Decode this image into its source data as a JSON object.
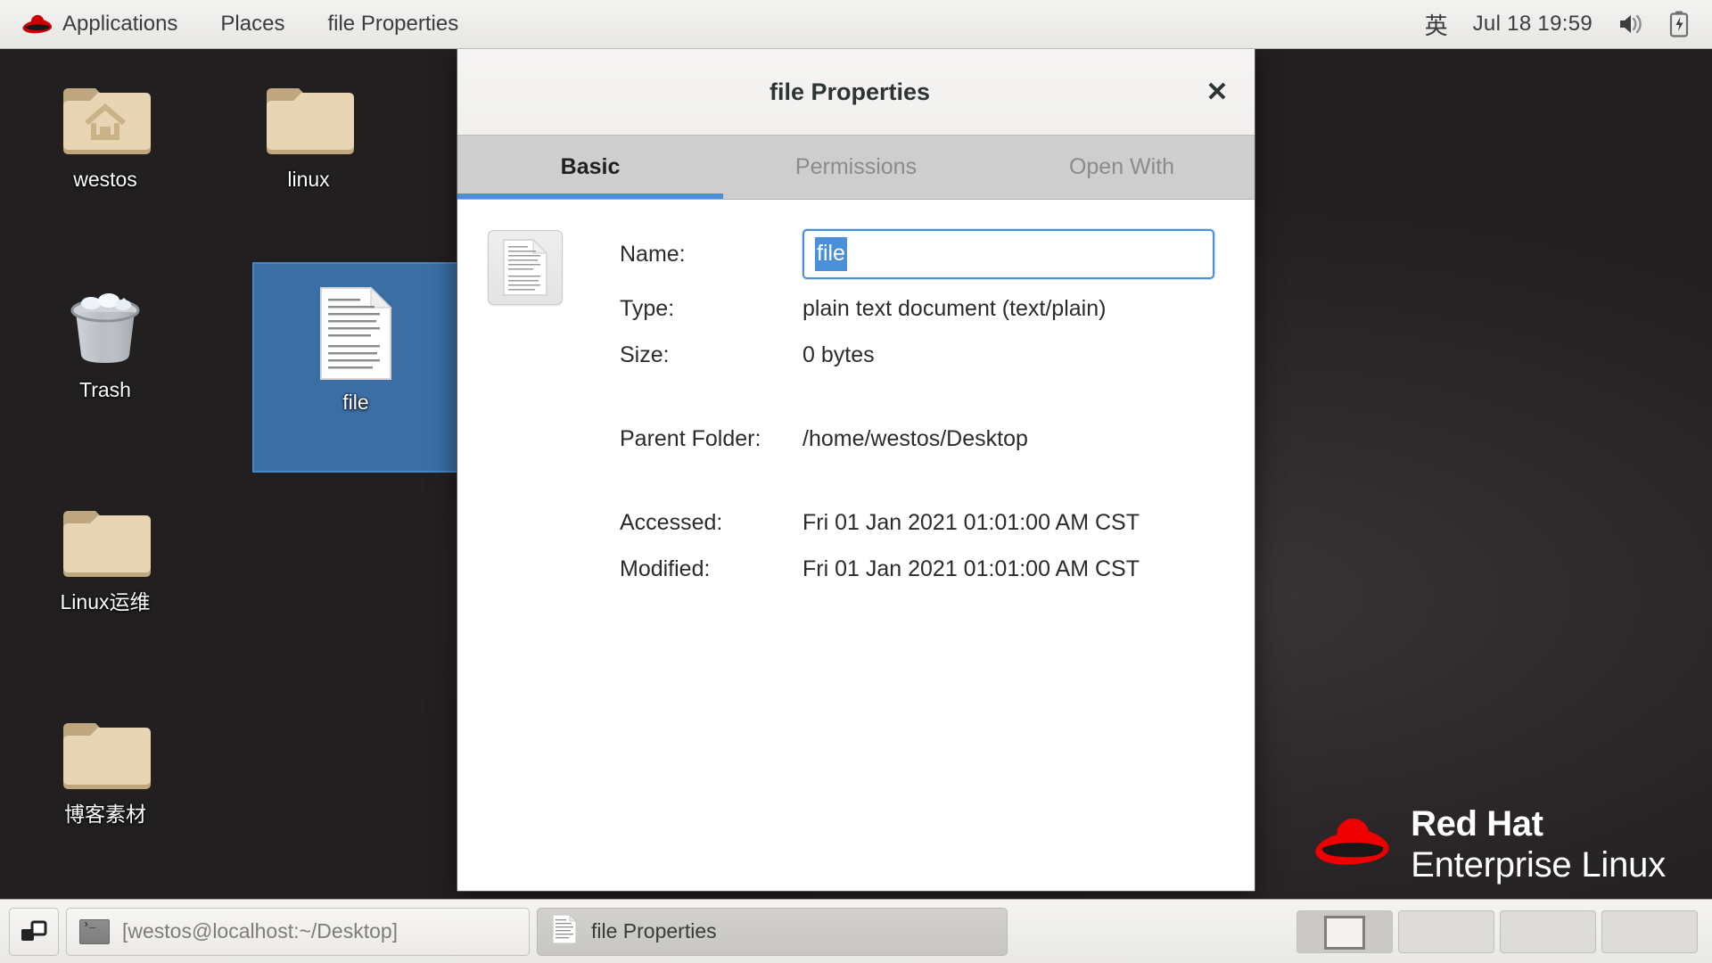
{
  "top_panel": {
    "logo_icon": "red-hat-logo-icon",
    "items": [
      {
        "label": "Applications"
      },
      {
        "label": "Places"
      },
      {
        "label": "file Properties"
      }
    ],
    "ime_indicator": "英",
    "clock": "Jul 18  19:59",
    "volume_icon": "volume-speaker-icon",
    "battery_icon": "battery-charging-icon"
  },
  "desktop": {
    "icons": [
      {
        "label": "westos",
        "type": "home-folder",
        "selected": false
      },
      {
        "label": "linux",
        "type": "folder",
        "selected": false
      },
      {
        "label": "Trash",
        "type": "trash",
        "selected": false
      },
      {
        "label": "file",
        "type": "text-document",
        "selected": true
      },
      {
        "label": "Linux运维",
        "type": "folder",
        "selected": false
      },
      {
        "label": "博客素材",
        "type": "folder",
        "selected": false
      }
    ],
    "branding": {
      "line1": "Red Hat",
      "line2": "Enterprise Linux",
      "logo_icon": "red-hat-fedora-icon",
      "logo_color": "#ee0000"
    }
  },
  "dialog": {
    "title": "file Properties",
    "close_label": "✕",
    "accent_color": "#4a90d9",
    "tabs": [
      {
        "label": "Basic",
        "active": true
      },
      {
        "label": "Permissions",
        "active": false
      },
      {
        "label": "Open With",
        "active": false
      }
    ],
    "file_icon": "text-document-icon",
    "fields": {
      "name_label": "Name:",
      "name_value": "file",
      "name_selected": true,
      "type_label": "Type:",
      "type_value": "plain text document (text/plain)",
      "size_label": "Size:",
      "size_value": "0 bytes",
      "parent_label": "Parent Folder:",
      "parent_value": "/home/westos/Desktop",
      "accessed_label": "Accessed:",
      "accessed_value": "Fri 01 Jan 2021 01:01:00 AM CST",
      "modified_label": "Modified:",
      "modified_value": "Fri 01 Jan 2021 01:01:00 AM CST"
    }
  },
  "taskbar": {
    "show_desktop_icon": "show-desktop-icon",
    "tasks": [
      {
        "label": "[westos@localhost:~/Desktop]",
        "icon": "terminal-icon",
        "active": false
      },
      {
        "label": "file Properties",
        "icon": "text-document-icon",
        "active": true
      }
    ],
    "workspaces": [
      {
        "active": true
      },
      {
        "active": false
      },
      {
        "active": false
      },
      {
        "active": false
      }
    ]
  }
}
